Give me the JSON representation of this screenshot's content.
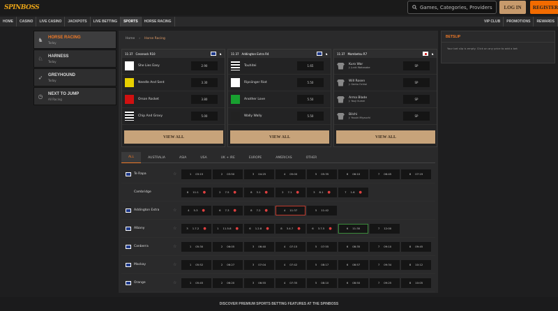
{
  "header": {
    "logo_main": "SPIN",
    "logo_sub": "BOSS",
    "search_placeholder": "Games, Categories, Providers",
    "login": "LOG IN",
    "register": "REGISTER"
  },
  "nav": {
    "left": [
      "HOME",
      "CASINO",
      "LIVE CASINO",
      "JACKPOTS",
      "LIVE BETTING",
      "SPORTS",
      "HORSE RACING"
    ],
    "right": [
      "VIP CLUB",
      "PROMOTIONS",
      "REWARDS"
    ]
  },
  "sidebar": [
    {
      "title": "HORSE RACING",
      "sub": "Today"
    },
    {
      "title": "HARNESS",
      "sub": "Today"
    },
    {
      "title": "GREYHOUND",
      "sub": "Today"
    },
    {
      "title": "NEXT TO JUMP",
      "sub": "All Racing"
    }
  ],
  "breadcrumb": {
    "home": "Home",
    "current": "Horse Racing"
  },
  "cards": [
    {
      "time": "11:37",
      "name": "Cessnock R10",
      "runners": [
        {
          "name": "She Lies Easy",
          "odd": "2.90",
          "silk": "#ffffff"
        },
        {
          "name": "Needle And Sent",
          "odd": "3.30",
          "silk": "#e8d000"
        },
        {
          "name": "Orson Rocket",
          "odd": "3.80",
          "silk": "#d01010"
        },
        {
          "name": "Chip And Grovy",
          "odd": "5.00",
          "silk": "stripe"
        }
      ],
      "view": "VIEW ALL"
    },
    {
      "time": "11:37",
      "name": "Addington Extra R4",
      "runners": [
        {
          "name": "Touhitei",
          "odd": "1.65",
          "silk": "stripe"
        },
        {
          "name": "Ripsiinger Riot",
          "odd": "5.50",
          "silk": "#ffffff"
        },
        {
          "name": "Another Love",
          "odd": "5.50",
          "silk": "#18a030"
        },
        {
          "name": "Wally Wally",
          "odd": "5.50",
          "silk": "#222222"
        }
      ],
      "view": "VIEW ALL"
    },
    {
      "time": "11:37",
      "name": "Mombetsu R7",
      "runners": [
        {
          "name": "Kuro War",
          "jockey": "J: Junki Watanabe",
          "odd": "SP"
        },
        {
          "name": "Will Rosen",
          "jockey": "J: Genta Ochiai",
          "odd": "SP"
        },
        {
          "name": "Arma Blade",
          "jockey": "J: Youji Kumei",
          "odd": "SP"
        },
        {
          "name": "Bilchi",
          "jockey": "J: Yusuki Miyauchi",
          "odd": "SP"
        }
      ],
      "view": "VIEW ALL"
    }
  ],
  "tabs": [
    "ALL",
    "AUSTRALIA",
    "ASIA",
    "USA",
    "UK + IRE",
    "EUROPE",
    "AMERICAS",
    "OTHER"
  ],
  "meetings": [
    {
      "name": "Te Rapa",
      "flag": true,
      "races": [
        [
          "1",
          "03:15"
        ],
        [
          "2",
          "03:50"
        ],
        [
          "3",
          "04:25"
        ],
        [
          "4",
          "05:00"
        ],
        [
          "5",
          "05:35"
        ],
        [
          "6",
          "06:10"
        ],
        [
          "7",
          "06:45"
        ],
        [
          "8",
          "07:19"
        ]
      ]
    },
    {
      "name": "Cambridge",
      "flag": false,
      "races": [
        [
          "8",
          "11:1"
        ],
        [
          "2",
          "7.5"
        ],
        [
          "8",
          "3.1"
        ],
        [
          "2",
          "7.1"
        ],
        [
          "3",
          "8.1"
        ],
        [
          "7",
          "1.6"
        ]
      ]
    },
    {
      "name": "Addington Extra",
      "flag": true,
      "races": [
        [
          "4",
          "5.3"
        ],
        [
          "6",
          "7.3"
        ],
        [
          "8",
          "7.2"
        ],
        [
          "4",
          "11:37"
        ],
        [
          "5",
          "11:42"
        ]
      ]
    },
    {
      "name": "Albany",
      "flag": true,
      "races": [
        [
          "3",
          "1.7.2"
        ],
        [
          "1",
          "11.5.8"
        ],
        [
          "6",
          "1.2.8"
        ],
        [
          "8",
          "3.4.7"
        ],
        [
          "6",
          "3.7.5"
        ],
        [
          "6",
          "11:30"
        ],
        [
          "7",
          "12:00"
        ]
      ]
    },
    {
      "name": "Canberra",
      "flag": true,
      "races": [
        [
          "1",
          "05:30"
        ],
        [
          "2",
          "06:05"
        ],
        [
          "3",
          "06:40"
        ],
        [
          "4",
          "07:15"
        ],
        [
          "5",
          "07:55"
        ],
        [
          "6",
          "08:35"
        ],
        [
          "7",
          "09:10"
        ],
        [
          "8",
          "09:45"
        ]
      ]
    },
    {
      "name": "Mackay",
      "flag": true,
      "races": [
        [
          "1",
          "05:52"
        ],
        [
          "2",
          "06:27"
        ],
        [
          "3",
          "07:04"
        ],
        [
          "4",
          "07:42"
        ],
        [
          "5",
          "08:17"
        ],
        [
          "6",
          "08:57"
        ],
        [
          "7",
          "09:34"
        ],
        [
          "8",
          "10:12"
        ]
      ]
    },
    {
      "name": "Orange",
      "flag": true,
      "races": [
        [
          "1",
          "05:45"
        ],
        [
          "2",
          "06:20"
        ],
        [
          "3",
          "06:55"
        ],
        [
          "4",
          "07:35"
        ],
        [
          "5",
          "08:10"
        ],
        [
          "6",
          "08:50"
        ],
        [
          "7",
          "09:25"
        ],
        [
          "8",
          "10:05"
        ]
      ]
    }
  ],
  "betslip": {
    "title": "BETSLIP",
    "message": "Your bet slip is empty. Click on any price to add a bet"
  },
  "footer": "DISCOVER PREMIUM SPORTS BETTING FEATURES AT THE SPINBOSS"
}
